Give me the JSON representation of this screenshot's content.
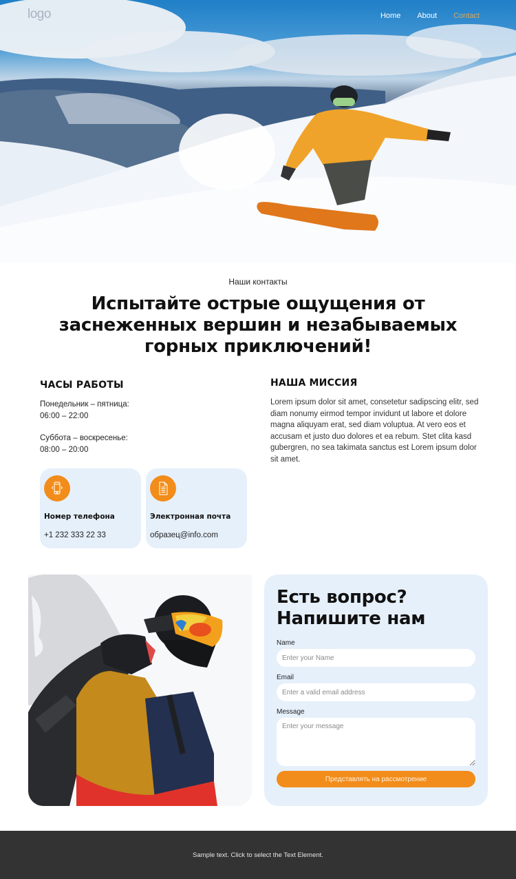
{
  "nav": {
    "logo": "logo",
    "links": [
      {
        "label": "Home",
        "active": false
      },
      {
        "label": "About",
        "active": false
      },
      {
        "label": "Contact",
        "active": true
      }
    ]
  },
  "hero": {
    "image": "snowboarder-carving-powder-icon"
  },
  "intro": {
    "kicker": "Наши контакты",
    "headline": "Испытайте острые ощущения от заснеженных вершин и незабываемых горных приключений!"
  },
  "hours": {
    "title": "ЧАСЫ РАБОТЫ",
    "blocks": [
      {
        "days": "Понедельник – пятница:",
        "time": "06:00 – 22:00"
      },
      {
        "days": "Суббота – воскресенье:",
        "time": "08:00 – 20:00"
      }
    ]
  },
  "mission": {
    "title": "НАША МИССИЯ",
    "text": "Lorem ipsum dolor sit amet, consetetur sadipscing elitr, sed diam nonumy eirmod tempor invidunt ut labore et dolore magna aliquyam erat, sed diam voluptua. At vero eos et accusam et justo duo dolores et ea rebum. Stet clita kasd gubergren, no sea takimata sanctus est Lorem ipsum dolor sit amet."
  },
  "contacts": [
    {
      "icon": "smartphone-icon",
      "title": "Номер телефона",
      "value": "+1 232 333 22 33"
    },
    {
      "icon": "document-icon",
      "title": "Электронная почта",
      "value": "образец@info.com"
    }
  ],
  "form": {
    "title_line1": "Есть вопрос?",
    "title_line2": "Напишите нам",
    "name_label": "Name",
    "name_placeholder": "Enter your Name",
    "email_label": "Email",
    "email_placeholder": "Enter a valid email address",
    "message_label": "Message",
    "message_placeholder": "Enter your message",
    "submit_label": "Представлять на рассмотрение"
  },
  "footer": {
    "text": "Sample text. Click to select the Text Element."
  },
  "colors": {
    "accent": "#f28c1a",
    "card_bg": "#e6f0fb",
    "footer_bg": "#333333",
    "nav_active": "#d8a860"
  }
}
